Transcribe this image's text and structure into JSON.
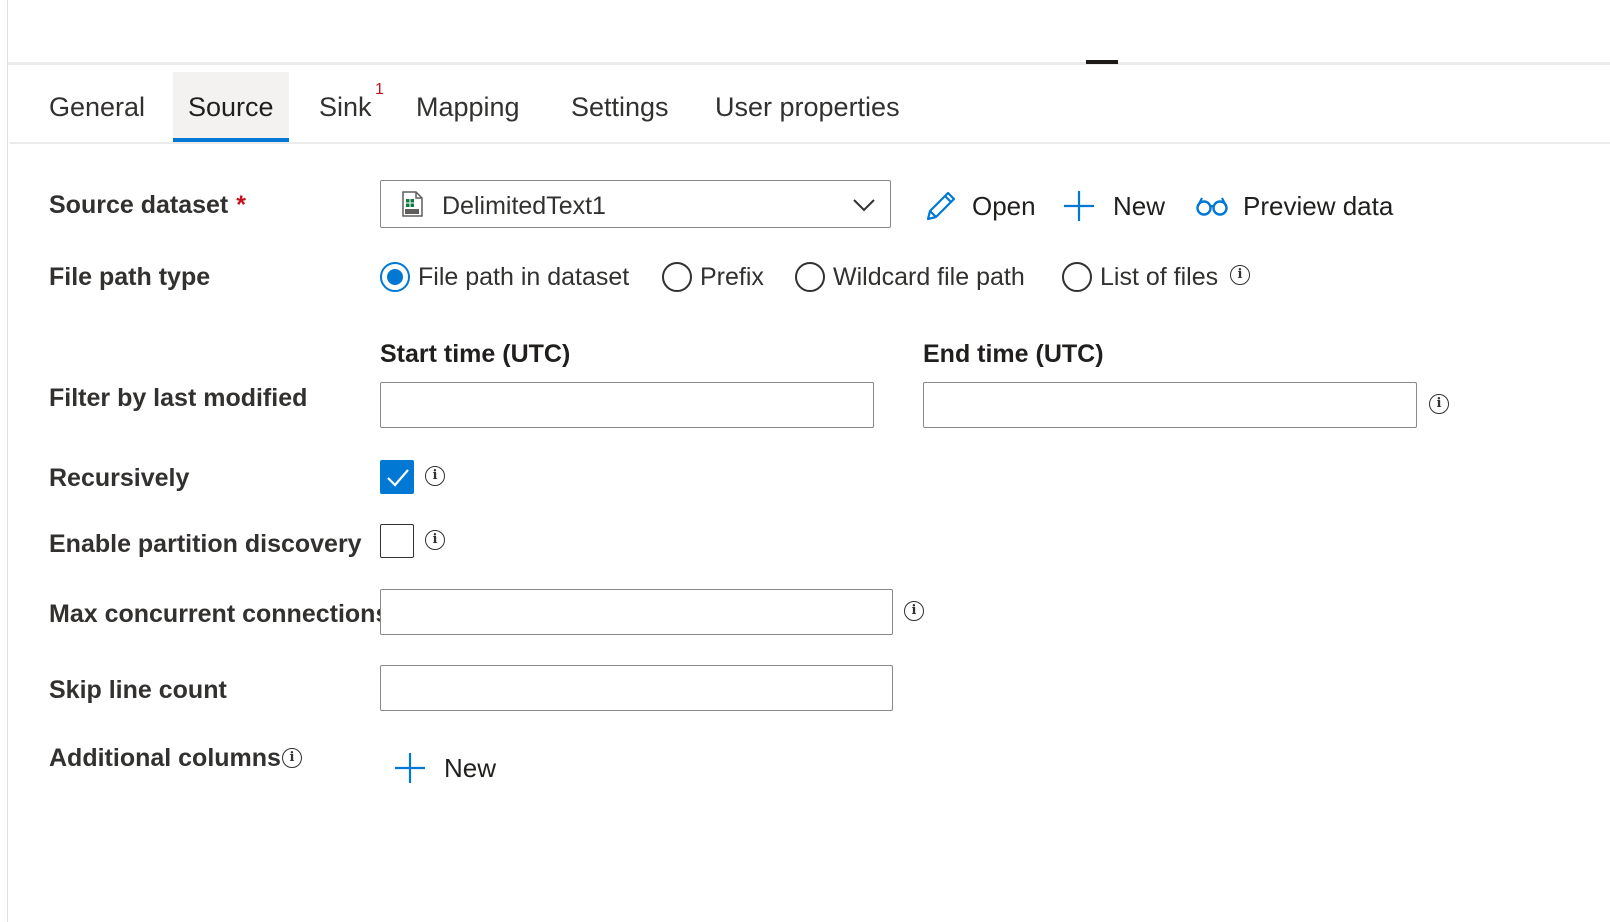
{
  "tabs": [
    {
      "label": "General"
    },
    {
      "label": "Source",
      "active": true
    },
    {
      "label": "Sink",
      "badge": "1"
    },
    {
      "label": "Mapping"
    },
    {
      "label": "Settings"
    },
    {
      "label": "User properties"
    }
  ],
  "source_dataset": {
    "label": "Source dataset",
    "required_mark": "*",
    "value": "DelimitedText1",
    "icon": "csv-file-icon",
    "actions": {
      "open": "Open",
      "new": "New",
      "preview": "Preview data"
    }
  },
  "file_path_type": {
    "label": "File path type",
    "options": [
      "File path in dataset",
      "Prefix",
      "Wildcard file path",
      "List of files"
    ],
    "selected": "File path in dataset"
  },
  "filter_last_modified": {
    "label": "Filter by last modified",
    "start_label": "Start time (UTC)",
    "end_label": "End time (UTC)",
    "start_value": "",
    "end_value": ""
  },
  "recursively": {
    "label": "Recursively",
    "checked": true
  },
  "partition_discovery": {
    "label": "Enable partition discovery",
    "checked": false
  },
  "max_connections": {
    "label": "Max concurrent connections",
    "value": ""
  },
  "skip_line_count": {
    "label": "Skip line count",
    "value": ""
  },
  "additional_columns": {
    "label": "Additional columns",
    "new_label": "New"
  },
  "colors": {
    "accent": "#0078d4",
    "required": "#c50f1f",
    "badge": "#c50f1f"
  }
}
